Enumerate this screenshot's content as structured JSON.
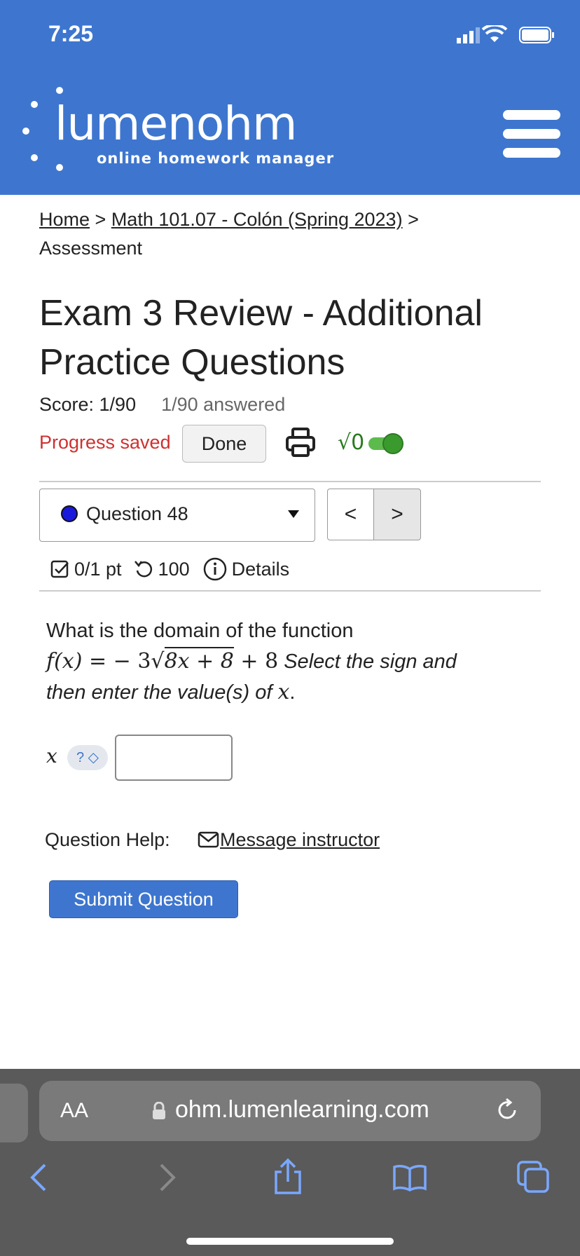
{
  "status_bar": {
    "time": "7:25"
  },
  "header": {
    "logo_word": "lumenohm",
    "logo_sub": "online homework manager"
  },
  "breadcrumb": {
    "home": "Home",
    "separator": " > ",
    "course": "Math 101.07 - Colón (Spring 2023)",
    "current": "Assessment"
  },
  "page_title": "Exam 3 Review - Additional Practice Questions",
  "score": {
    "label": "Score: 1/90",
    "answered": "1/90 answered"
  },
  "toolbar": {
    "progress": "Progress saved",
    "done_label": "Done",
    "sqrt_label": "√0"
  },
  "question_nav": {
    "selected": "Question 48",
    "prev": "<",
    "next": ">"
  },
  "question_meta": {
    "points": "0/1 pt",
    "retries": "100",
    "details": "Details"
  },
  "question": {
    "prompt": "What is the domain of the function",
    "fx": "f(x)",
    "eq": " = ",
    "coef": "− 3",
    "radicand": "8x + 8",
    "tail": " + 8",
    "instruction_a": "Select the sign and",
    "instruction_b": "then enter the value(s) of",
    "var": "x",
    "period": "."
  },
  "answer": {
    "var": "x",
    "sign_placeholder": "? ◇",
    "value": ""
  },
  "help": {
    "label": "Question Help:",
    "link": "Message instructor"
  },
  "submit_label": "Submit Question",
  "browser": {
    "aa": "AA",
    "url": "ohm.lumenlearning.com"
  },
  "colors": {
    "brand_blue": "#3e76cf",
    "progress_red": "#d03030",
    "toggle_green": "#3a9a2e"
  }
}
